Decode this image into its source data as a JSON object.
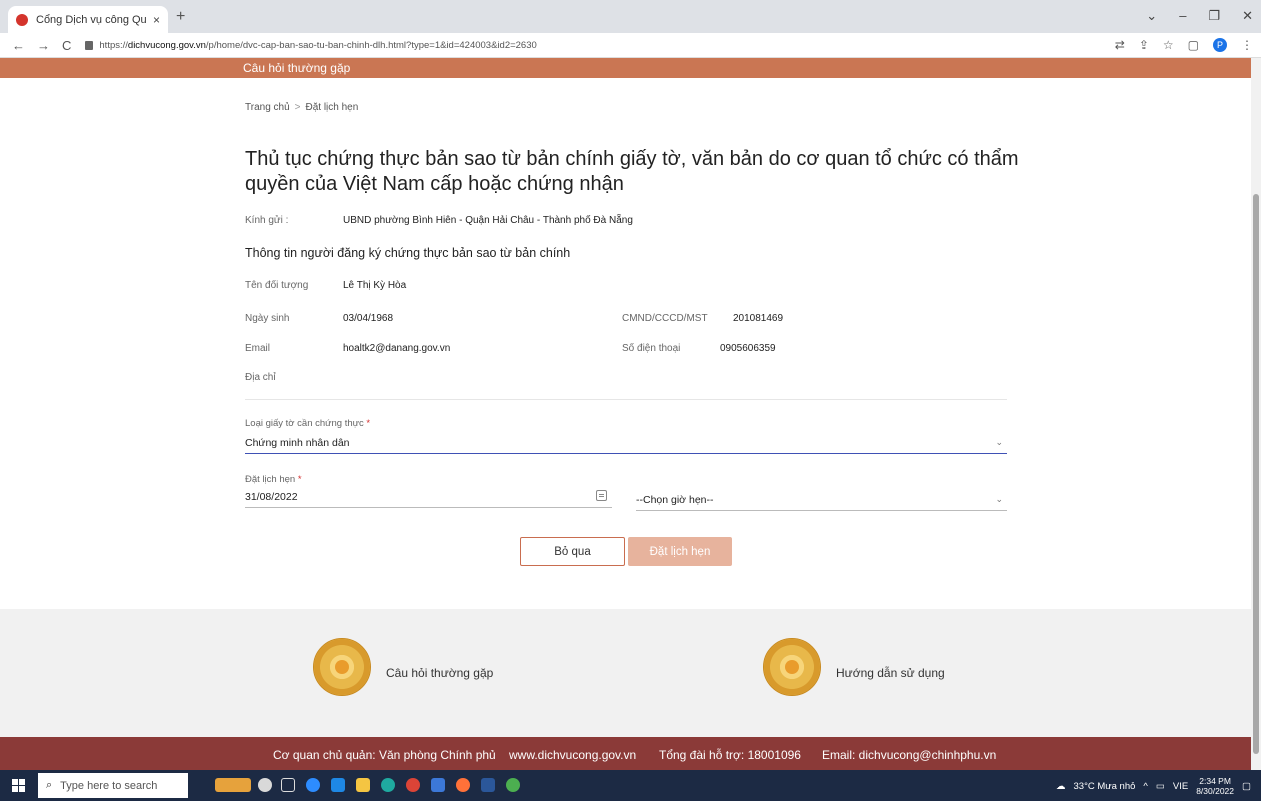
{
  "browser": {
    "tab_title": "Cổng Dịch vụ công Quốc gia",
    "tab_close": "×",
    "new_tab": "+",
    "url_prefix": "https://",
    "url_host": "dichvucong.gov.vn",
    "url_path": "/p/home/dvc-cap-ban-sao-tu-ban-chinh-dlh.html?type=1&id=424003&id2=2630",
    "profile_initial": "P"
  },
  "page": {
    "top_link": "Câu hỏi thường gặp",
    "breadcrumb": {
      "home": "Trang chủ",
      "sep": ">",
      "current": "Đặt lịch hẹn"
    },
    "title": "Thủ tục chứng thực bản sao từ bản chính giấy tờ, văn bản do cơ quan tổ chức có thẩm quyền của Việt Nam cấp hoặc chứng nhận",
    "recipient_label": "Kính gửi :",
    "recipient_value": "UBND phường Bình Hiên - Quận Hải Châu - Thành phố Đà Nẵng",
    "section_heading": "Thông tin người đăng ký chứng thực bản sao từ bản chính",
    "fields": {
      "name_label": "Tên đối tượng",
      "name_value": "Lê Thị Kỳ Hòa",
      "dob_label": "Ngày sinh",
      "dob_value": "03/04/1968",
      "id_label": "CMND/CCCD/MST",
      "id_value": "201081469",
      "email_label": "Email",
      "email_value": "hoaltk2@danang.gov.vn",
      "phone_label": "Số điện thoại",
      "phone_value": "0905606359",
      "address_label": "Địa chỉ"
    },
    "doc_type": {
      "label": "Loại giấy tờ cần chứng thực",
      "required": "*",
      "value": "Chứng minh nhân dân"
    },
    "appointment": {
      "label": "Đặt lịch hẹn",
      "required": "*",
      "date_value": "31/08/2022",
      "time_placeholder": "--Chọn giờ hẹn--"
    },
    "buttons": {
      "skip": "Bỏ qua",
      "book": "Đặt lịch hẹn"
    },
    "footer_links": {
      "faq": "Câu hỏi thường gặp",
      "guide": "Hướng dẫn sử dụng"
    },
    "bottom": {
      "agency": "Cơ quan chủ quản: Văn phòng Chính phủ",
      "site": "www.dichvucong.gov.vn",
      "hotline": "Tổng đài hỗ trợ: 18001096",
      "email": "Email: dichvucong@chinhphu.vn"
    }
  },
  "taskbar": {
    "search_placeholder": "Type here to search",
    "weather": "33°C Mưa nhỏ",
    "lang": "VIE",
    "time": "2:34 PM",
    "date": "8/30/2022"
  },
  "colors": {
    "accent": "#ca7653",
    "footer_band": "#8b3a38",
    "book_button": "#e7b39d"
  }
}
